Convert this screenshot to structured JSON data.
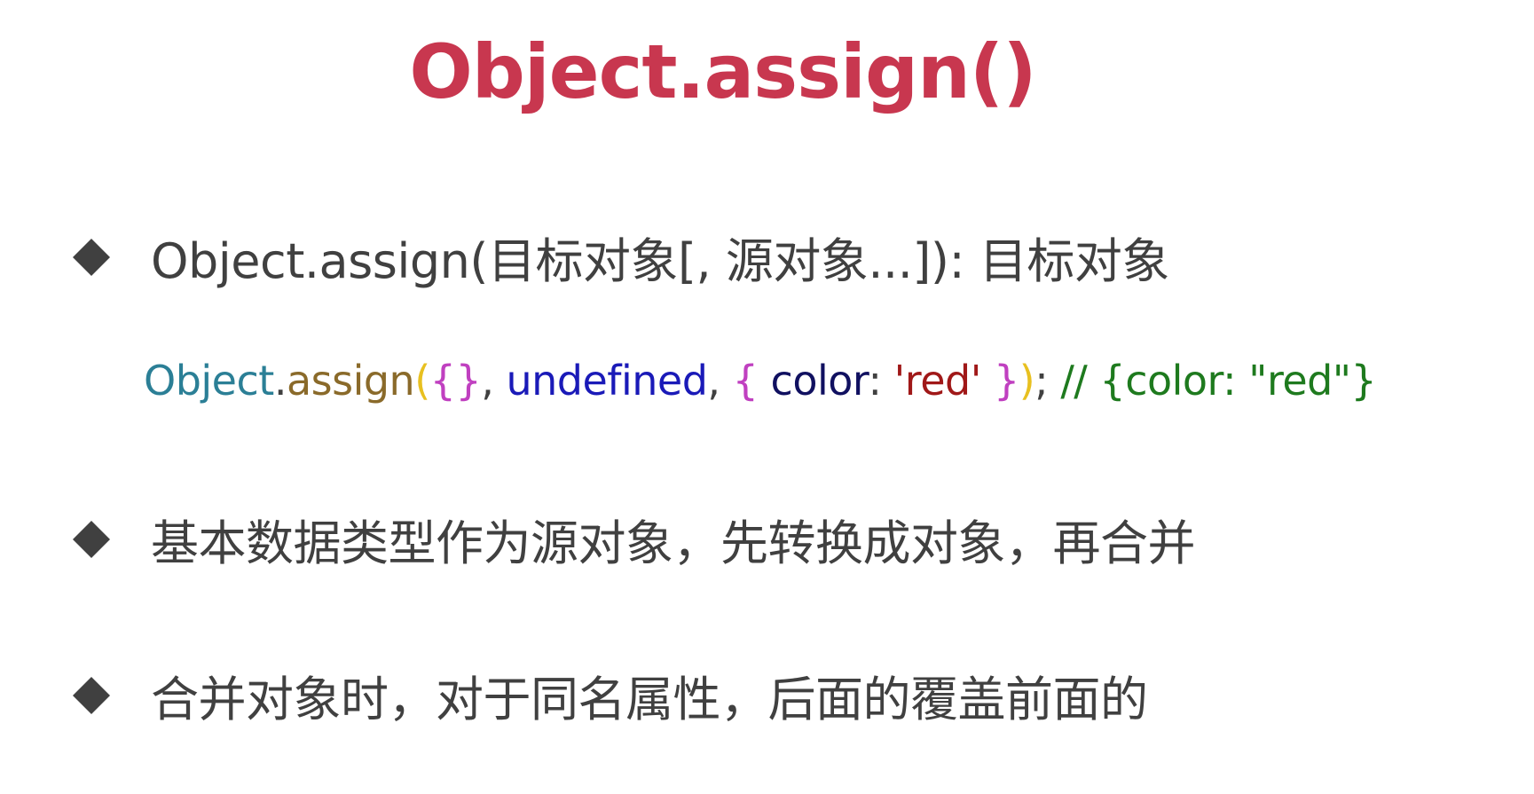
{
  "title": "Object.assign()",
  "bullets": [
    {
      "text": "Object.assign(目标对象[, 源对象...]): 目标对象"
    },
    {
      "text": "基本数据类型作为源对象，先转换成对象，再合并"
    },
    {
      "text": "合并对象时，对于同名属性，后面的覆盖前面的"
    }
  ],
  "code": {
    "tokens": [
      {
        "text": "Object",
        "color": "#2b7f96"
      },
      {
        "text": ".",
        "color": "#404040"
      },
      {
        "text": "assign",
        "color": "#8a6a2a"
      },
      {
        "text": "(",
        "color": "#e8c020"
      },
      {
        "text": "{}",
        "color": "#c040c0"
      },
      {
        "text": ", ",
        "color": "#404040"
      },
      {
        "text": "undefined",
        "color": "#1a1ab8"
      },
      {
        "text": ", ",
        "color": "#404040"
      },
      {
        "text": "{ ",
        "color": "#c040c0"
      },
      {
        "text": "color",
        "color": "#101060"
      },
      {
        "text": ": ",
        "color": "#404040"
      },
      {
        "text": "'red'",
        "color": "#a01818"
      },
      {
        "text": " }",
        "color": "#c040c0"
      },
      {
        "text": ")",
        "color": "#e8c020"
      },
      {
        "text": "; ",
        "color": "#404040"
      },
      {
        "text": "// {color: \"red\"}",
        "color": "#1e7a1e"
      }
    ]
  },
  "colors": {
    "title": "#c8374f",
    "body_text": "#404040",
    "bullet": "#404040",
    "background": "#ffffff"
  },
  "icons": {
    "bullet": "diamond-icon"
  }
}
